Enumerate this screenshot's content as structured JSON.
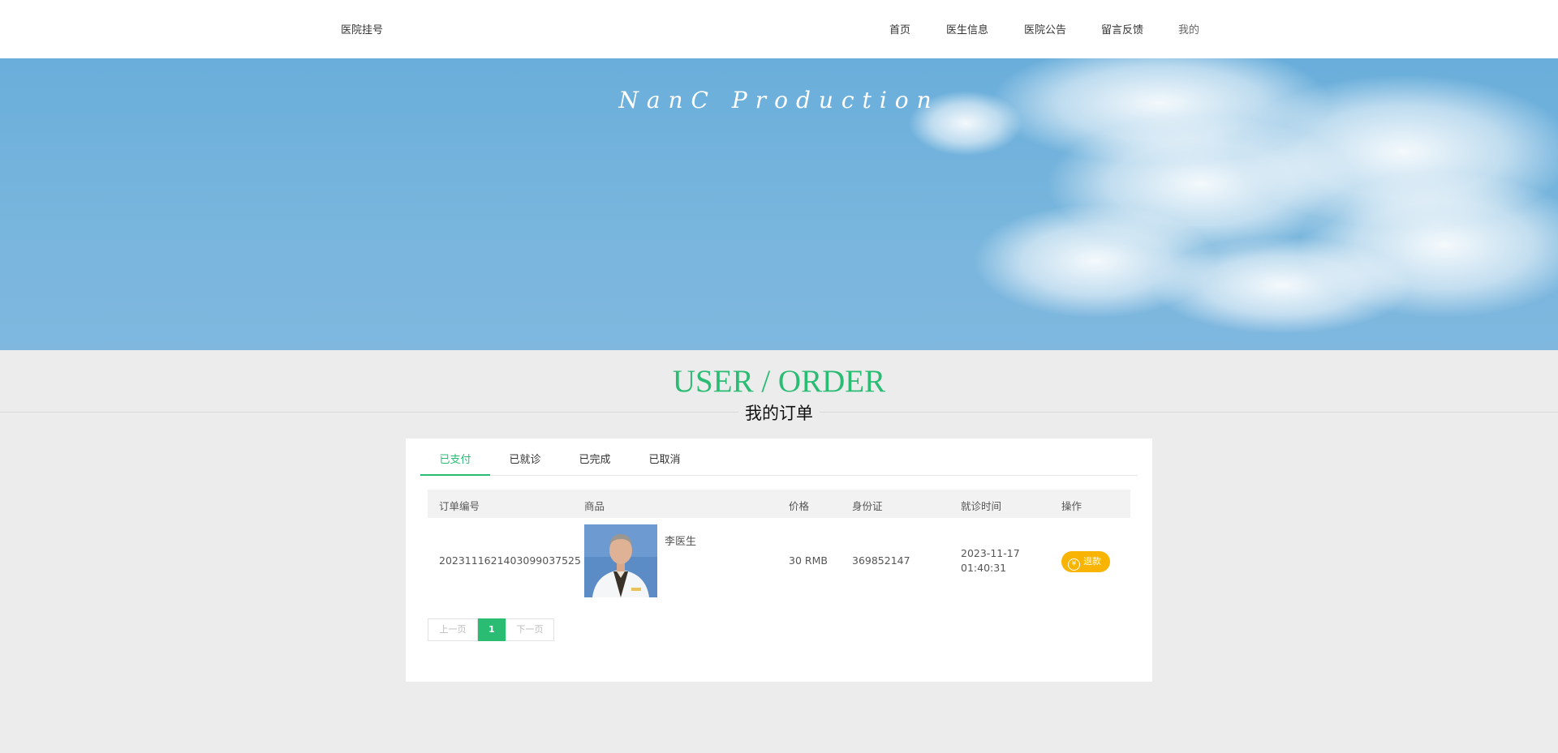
{
  "header": {
    "brand": "医院挂号",
    "nav": [
      "首页",
      "医生信息",
      "医院公告",
      "留言反馈",
      "我的"
    ]
  },
  "banner": {
    "title": "NanC  Production"
  },
  "section": {
    "title": "USER / ORDER",
    "subtitle": "我的订单"
  },
  "tabs": [
    "已支付",
    "已就诊",
    "已完成",
    "已取消"
  ],
  "table": {
    "headers": [
      "订单编号",
      "商品",
      "价格",
      "身份证",
      "就诊时间",
      "操作"
    ],
    "rows": [
      {
        "order_no": "20231116214030990375​25",
        "product": "李医生",
        "price": "30 RMB",
        "id_card": "369852147",
        "date": "2023-11-17",
        "time": "01:40:31",
        "action": "退款",
        "action_icon": "¥"
      }
    ]
  },
  "pagination": {
    "prev": "上一页",
    "current": "1",
    "next": "下一页"
  },
  "colors": {
    "accent": "#2bbc74",
    "refund": "#f8b400"
  }
}
